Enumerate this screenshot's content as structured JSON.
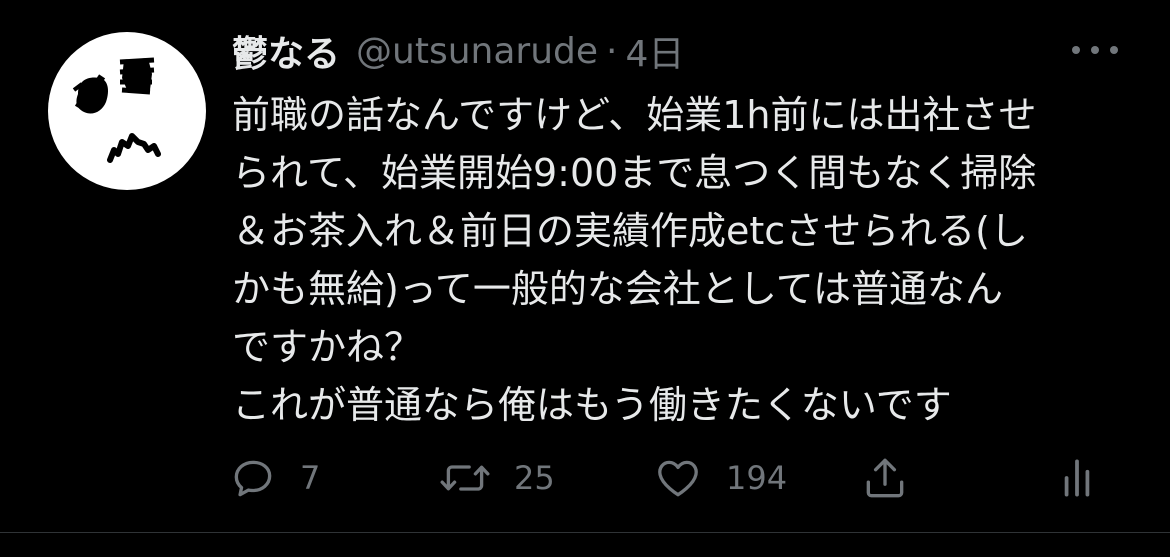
{
  "tweet": {
    "display_name": "鬱なる",
    "handle": "@utsunarude",
    "separator": "·",
    "time": "4日",
    "body_lines": [
      "前職の話なんですけど、始業1h前には出社させ",
      "られて、始業開始9:00まで息つく間もなく掃除",
      "＆お茶入れ＆前日の実績作成etcさせられる(し",
      "かも無給)って一般的な会社としては普通なん",
      "ですかね？",
      "これが普通なら俺はもう働きたくないです"
    ],
    "actions": {
      "reply_count": "7",
      "retweet_count": "25",
      "like_count": "194"
    }
  },
  "icons": {
    "more": "more-horizontal-icon",
    "reply": "reply-icon",
    "retweet": "retweet-icon",
    "like": "heart-icon",
    "share": "share-icon",
    "stats": "stats-icon"
  },
  "colors": {
    "background": "#000000",
    "primary_text": "#e7e9ea",
    "secondary_text": "#71767b",
    "divider": "#2f3336"
  }
}
